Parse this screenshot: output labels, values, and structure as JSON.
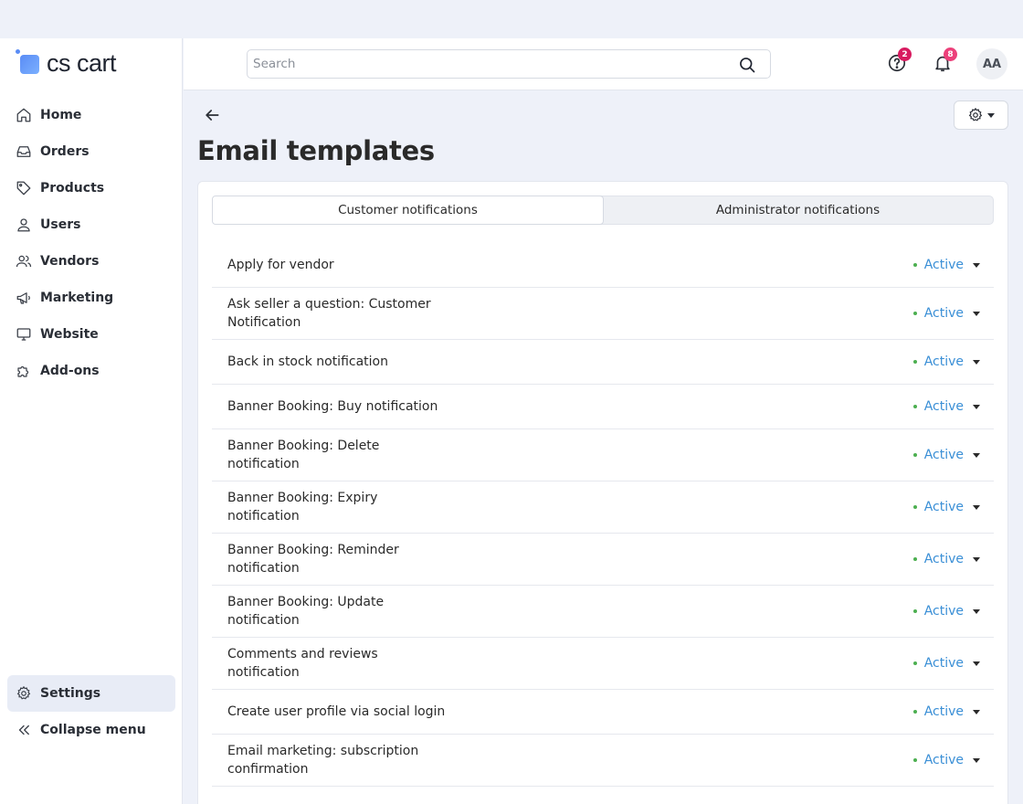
{
  "logo": {
    "text": "cs cart"
  },
  "sidebar": {
    "items": [
      {
        "label": "Home",
        "icon": "home-icon"
      },
      {
        "label": "Orders",
        "icon": "inbox-icon"
      },
      {
        "label": "Products",
        "icon": "tag-icon"
      },
      {
        "label": "Users",
        "icon": "user-icon"
      },
      {
        "label": "Vendors",
        "icon": "users-icon"
      },
      {
        "label": "Marketing",
        "icon": "megaphone-icon"
      },
      {
        "label": "Website",
        "icon": "monitor-icon"
      },
      {
        "label": "Add-ons",
        "icon": "puzzle-icon"
      }
    ],
    "settings_label": "Settings",
    "collapse_label": "Collapse menu"
  },
  "header": {
    "search_placeholder": "Search",
    "help_badge": "2",
    "notifications_badge": "8",
    "avatar_initials": "AA",
    "help_badge_color": "#d81b60",
    "notifications_badge_color": "#ec407a"
  },
  "page": {
    "title": "Email templates"
  },
  "tabs": [
    {
      "label": "Customer notifications",
      "active": true
    },
    {
      "label": "Administrator notifications",
      "active": false
    }
  ],
  "templates": [
    {
      "name": "Apply for vendor",
      "status": "Active"
    },
    {
      "name": "Ask seller a question: Customer Notification",
      "status": "Active"
    },
    {
      "name": "Back in stock notification",
      "status": "Active"
    },
    {
      "name": "Banner Booking: Buy notification",
      "status": "Active"
    },
    {
      "name": "Banner Booking: Delete notification",
      "status": "Active"
    },
    {
      "name": "Banner Booking: Expiry notification",
      "status": "Active"
    },
    {
      "name": "Banner Booking: Reminder notification",
      "status": "Active"
    },
    {
      "name": "Banner Booking: Update notification",
      "status": "Active"
    },
    {
      "name": "Comments and reviews notification",
      "status": "Active"
    },
    {
      "name": "Create user profile via social login",
      "status": "Active"
    },
    {
      "name": "Email marketing: subscription confirmation",
      "status": "Active"
    }
  ],
  "colors": {
    "status_active_text": "#3a8fd6",
    "status_active_dot": "#4caf50",
    "accent": "#5a8cf5"
  }
}
